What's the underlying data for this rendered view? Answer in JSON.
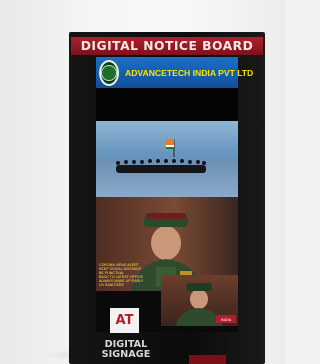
{
  "board": {
    "title": "DIGITAL NOTICE BOARD",
    "company": "ADVANCETECH INDIA PVT LTD",
    "logo_text": "AT",
    "signage": [
      "DIGITAL",
      "SIGNAGE"
    ]
  },
  "screen": {
    "notice_lines": [
      "Corona Virus Alert",
      "KEEP SOCIAL DISTANCE",
      "BE PUNCTUAL",
      "back to Latest office",
      "Always wake up early",
      "UV Sanitizer"
    ],
    "tag": "INDIA"
  },
  "colors": {
    "header_red": "#b01e2b",
    "company_text": "#ffe300",
    "topbar_blue": "#1b6fc6"
  }
}
